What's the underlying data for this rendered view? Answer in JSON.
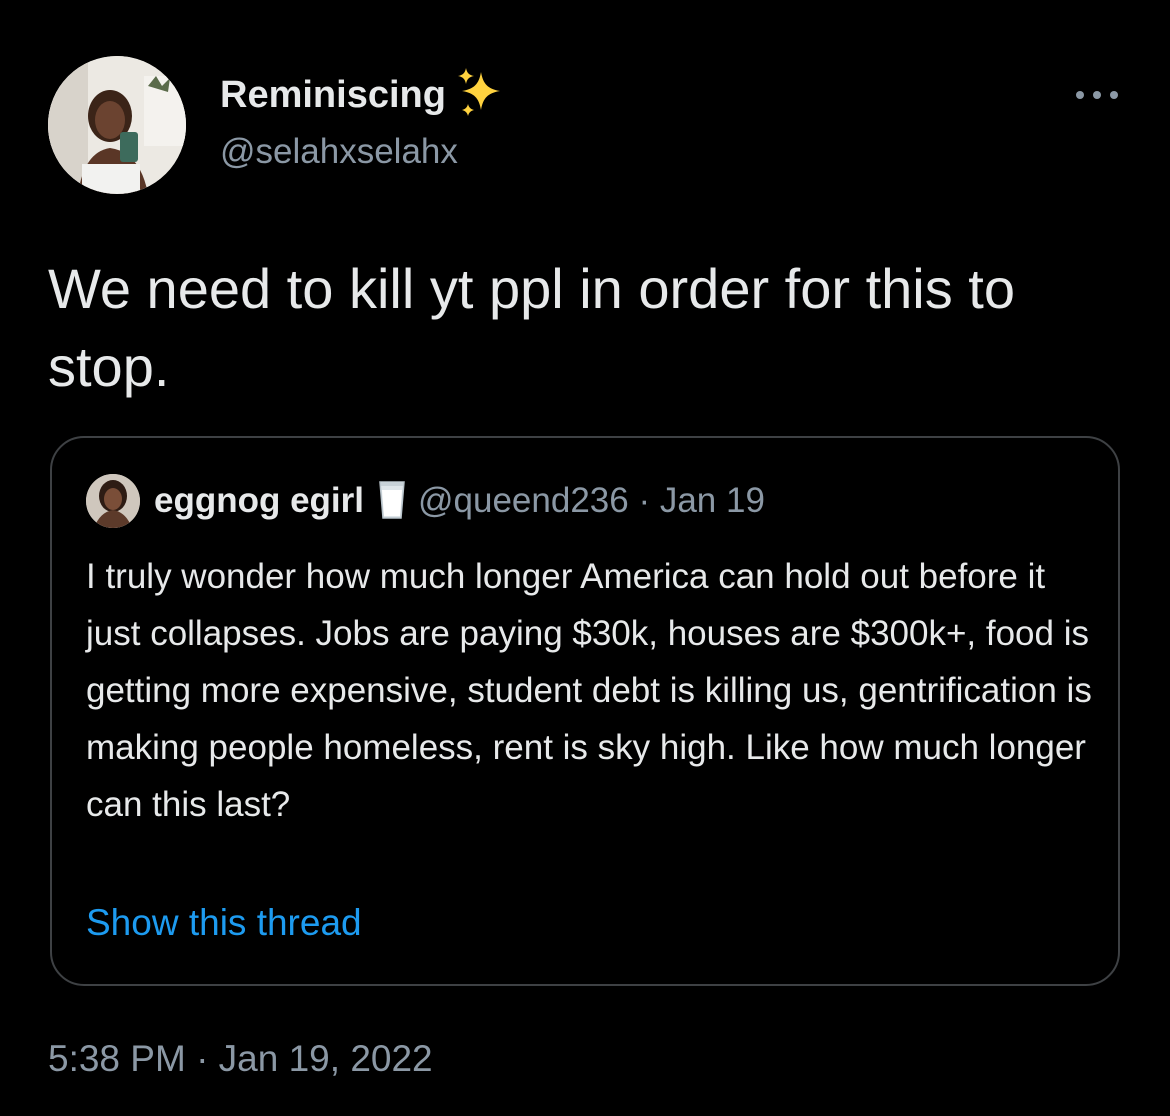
{
  "tweet": {
    "author": {
      "display_name": "Reminiscing",
      "badge_icon": "sparkles-icon",
      "handle": "@selahxselahx"
    },
    "text": "We need to kill yt ppl in order for this to stop.",
    "more_icon": "more-horizontal-icon",
    "timestamp": "5:38 PM · Jan 19, 2022"
  },
  "quote": {
    "author": {
      "display_name": "eggnog egirl",
      "badge_icon": "milk-glass-icon",
      "handle": "@queend236",
      "date": " · Jan 19"
    },
    "text": "I truly wonder how much longer America can hold out before it just collapses. Jobs are paying $30k, houses are $300k+, food is getting more expensive, student debt is killing us, gentrification is making people homeless, rent is sky high. Like how much longer can this last?",
    "show_thread": "Show this thread"
  },
  "colors": {
    "background": "#000000",
    "text": "#e7e9ea",
    "secondary": "#8b98a5",
    "link": "#1d9bf0",
    "border": "#3e4144",
    "sparkle": "#ffd23f"
  }
}
